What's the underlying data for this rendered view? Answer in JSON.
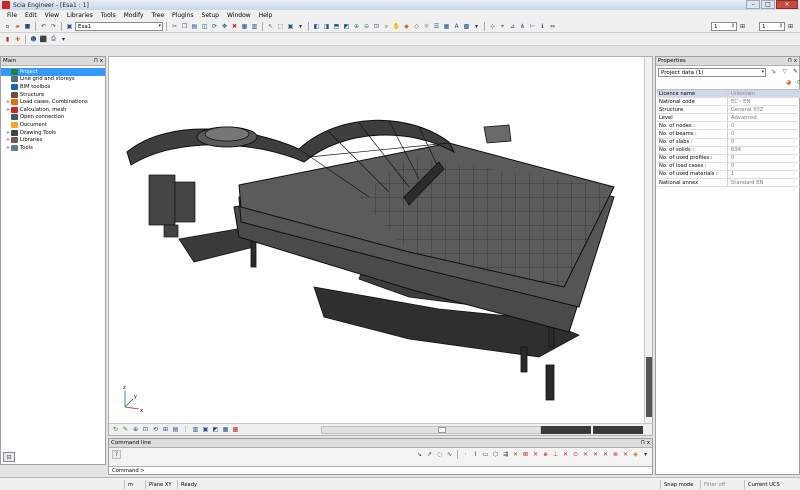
{
  "window": {
    "title": "Scia Engineer - [Esa1 : 1]",
    "min": "–",
    "max": "□",
    "close": "✕"
  },
  "menu": [
    "File",
    "Edit",
    "View",
    "Libraries",
    "Tools",
    "Modify",
    "Tree",
    "Plugins",
    "Setup",
    "Window",
    "Help"
  ],
  "toolbar": {
    "project_combo": "Esa1",
    "spin1_value": "1",
    "spin2_value": "1"
  },
  "left_panel": {
    "title": "Main",
    "pin": "⊓ x",
    "tree": [
      {
        "label": "Project",
        "selected": true,
        "expand": "",
        "icon_color": "#2e7d32"
      },
      {
        "label": "Line grid and storeys",
        "selected": false,
        "expand": "",
        "icon_color": "#546e7a"
      },
      {
        "label": "BIM toolbox",
        "selected": false,
        "expand": "",
        "icon_color": "#1565c0"
      },
      {
        "label": "Structure",
        "selected": false,
        "expand": "",
        "icon_color": "#6d4c41"
      },
      {
        "label": "Load cases, Combinations",
        "selected": false,
        "expand": "+",
        "icon_color": "#ef6c00"
      },
      {
        "label": "Calculation, mesh",
        "selected": false,
        "expand": "+",
        "icon_color": "#c62828"
      },
      {
        "label": "Open connection",
        "selected": false,
        "expand": "",
        "icon_color": "#455a64"
      },
      {
        "label": "Document",
        "selected": false,
        "expand": "",
        "icon_color": "#f9a825"
      },
      {
        "label": "Drawing Tools",
        "selected": false,
        "expand": "+",
        "icon_color": "#37474f"
      },
      {
        "label": "Libraries",
        "selected": false,
        "expand": "+",
        "icon_color": "#795548"
      },
      {
        "label": "Tools",
        "selected": false,
        "expand": "+",
        "icon_color": "#607d8b"
      }
    ]
  },
  "command_line": {
    "title": "Command line",
    "pin": "⊓ x",
    "prompt": "Command >"
  },
  "right_panel": {
    "title": "Properties",
    "pin": "⊓ x",
    "selector": "Project data (1)",
    "properties": [
      {
        "key": "Licence name",
        "value": "Unknown",
        "highlight": true
      },
      {
        "key": "National code",
        "value": "EC - EN",
        "highlight": false
      },
      {
        "key": "Structure",
        "value": "General XYZ",
        "highlight": false
      },
      {
        "key": "Level",
        "value": "Advanced",
        "highlight": false
      },
      {
        "key": "No. of nodes :",
        "value": "0",
        "highlight": false
      },
      {
        "key": "No. of beams :",
        "value": "0",
        "highlight": false
      },
      {
        "key": "No. of slabs :",
        "value": "0",
        "highlight": false
      },
      {
        "key": "No. of solids :",
        "value": "634",
        "highlight": false
      },
      {
        "key": "No. of used profiles :",
        "value": "0",
        "highlight": false
      },
      {
        "key": "No. of load cases :",
        "value": "0",
        "highlight": false
      },
      {
        "key": "No. of used materials :",
        "value": "1",
        "highlight": false
      },
      {
        "key": "National annex",
        "value": "Standard EN",
        "highlight": false
      }
    ]
  },
  "status": {
    "units": "m",
    "plane": "Plane XY",
    "state": "Ready",
    "snap": "Snap mode",
    "filter": "Filter off",
    "ucs": "Current UCS"
  },
  "axes": {
    "x": "x",
    "y": "y",
    "z": "z"
  }
}
